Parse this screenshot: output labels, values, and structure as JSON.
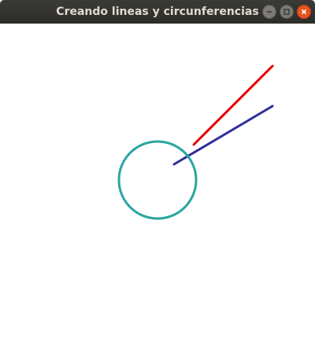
{
  "window": {
    "title": "Creando lineas y circunferencias"
  },
  "titlebar_controls": [
    "minimize-icon",
    "maximize-icon",
    "close-icon"
  ],
  "colors": {
    "red_line": "#e60000",
    "blue_line": "#2e2e99",
    "circle": "#2aa5a0",
    "close_button": "#e95420"
  }
}
